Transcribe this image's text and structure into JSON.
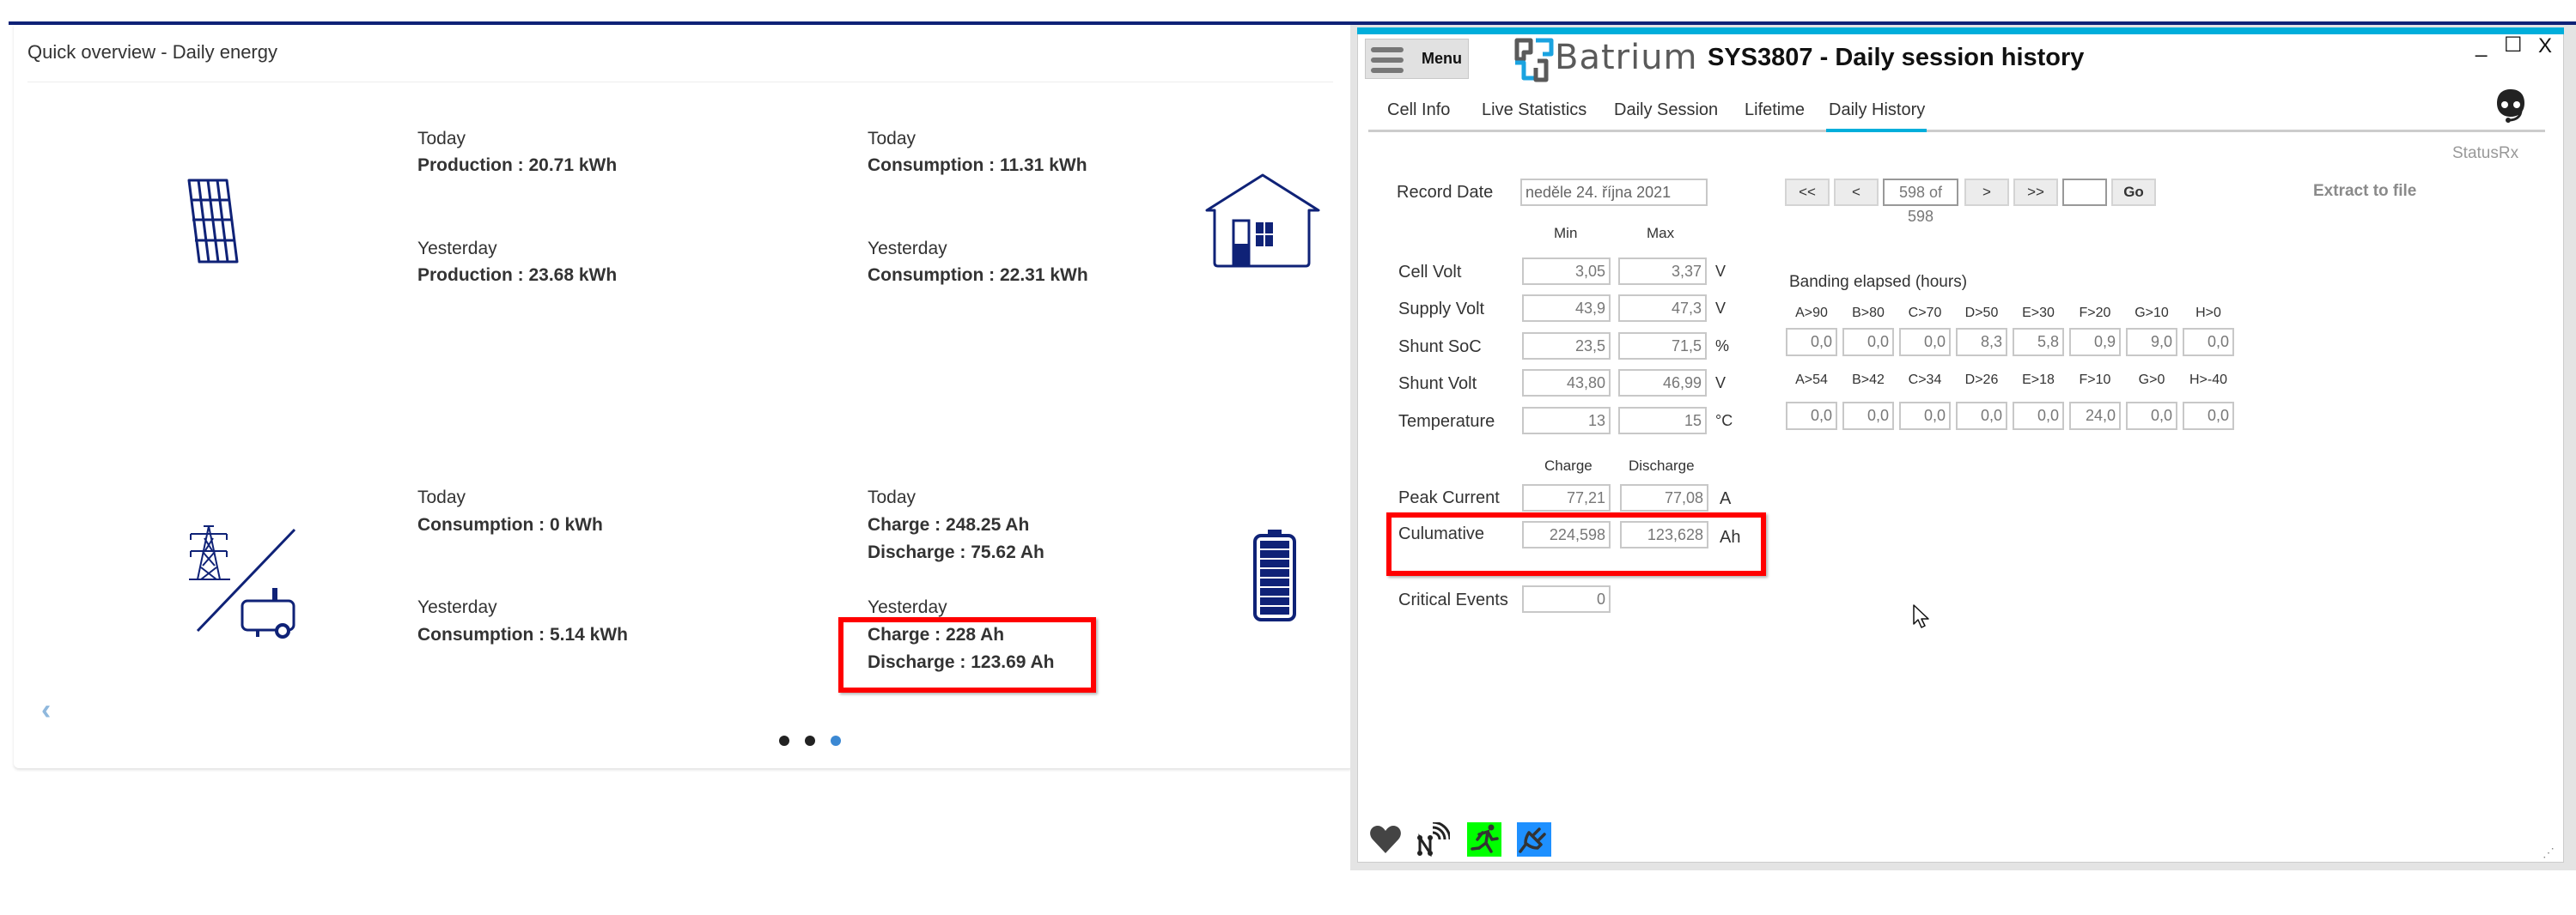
{
  "overview": {
    "title": "Quick overview - Daily energy",
    "sections": [
      {
        "icon": "solar-panel-icon",
        "today_label": "Today",
        "today_values": [
          "Production : 20.71 kWh"
        ],
        "yesterday_label": "Yesterday",
        "yesterday_values": [
          "Production : 23.68 kWh"
        ]
      },
      {
        "icon": "house-icon",
        "today_label": "Today",
        "today_values": [
          "Consumption : 11.31 kWh"
        ],
        "yesterday_label": "Yesterday",
        "yesterday_values": [
          "Consumption : 22.31 kWh"
        ]
      },
      {
        "icon": "grid-generator-icon",
        "today_label": "Today",
        "today_values": [
          "Consumption : 0 kWh"
        ],
        "yesterday_label": "Yesterday",
        "yesterday_values": [
          "Consumption : 5.14 kWh"
        ]
      },
      {
        "icon": "battery-icon",
        "today_label": "Today",
        "today_values": [
          "Charge : 248.25 Ah",
          "Discharge : 75.62 Ah"
        ],
        "yesterday_label": "Yesterday",
        "yesterday_values": [
          "Charge : 228 Ah",
          "Discharge : 123.69 Ah"
        ]
      }
    ],
    "carousel": {
      "pages": 3,
      "active_page": 3
    },
    "prev_icon": "chevron-left-icon"
  },
  "window": {
    "menu_label": "Menu",
    "logo_text": "Batrium",
    "title": "SYS3807 - Daily session history",
    "controls": {
      "minimize": "_",
      "maximize": "☐",
      "close": "X"
    },
    "tabs": [
      {
        "label": "Cell Info",
        "active": false
      },
      {
        "label": "Live Statistics",
        "active": false
      },
      {
        "label": "Daily Session",
        "active": false
      },
      {
        "label": "Lifetime",
        "active": false
      },
      {
        "label": "Daily History",
        "active": true
      }
    ],
    "status_text": "StatusRx",
    "record_date_label": "Record Date",
    "record_date_value": "neděle 24. října 2021",
    "nav": {
      "first": "<<",
      "prev": "<",
      "position": "598 of 598",
      "next": ">",
      "last": ">>",
      "goto_value": "",
      "go": "Go"
    },
    "extract_label": "Extract to file",
    "minmax_headers": {
      "min": "Min",
      "max": "Max"
    },
    "measurements": [
      {
        "label": "Cell Volt",
        "min": "3,05",
        "max": "3,37",
        "unit": "V"
      },
      {
        "label": "Supply Volt",
        "min": "43,9",
        "max": "47,3",
        "unit": "V"
      },
      {
        "label": "Shunt SoC",
        "min": "23,5",
        "max": "71,5",
        "unit": "%"
      },
      {
        "label": "Shunt Volt",
        "min": "43,80",
        "max": "46,99",
        "unit": "V"
      },
      {
        "label": "Temperature",
        "min": "13",
        "max": "15",
        "unit": "°C"
      }
    ],
    "banding": {
      "title": "Banding elapsed (hours)",
      "soc_bands": [
        {
          "label": "A>90",
          "value": "0,0"
        },
        {
          "label": "B>80",
          "value": "0,0"
        },
        {
          "label": "C>70",
          "value": "0,0"
        },
        {
          "label": "D>50",
          "value": "8,3"
        },
        {
          "label": "E>30",
          "value": "5,8"
        },
        {
          "label": "F>20",
          "value": "0,9"
        },
        {
          "label": "G>10",
          "value": "9,0"
        },
        {
          "label": "H>0",
          "value": "0,0"
        }
      ],
      "temp_bands": [
        {
          "label": "A>54",
          "value": "0,0"
        },
        {
          "label": "B>42",
          "value": "0,0"
        },
        {
          "label": "C>34",
          "value": "0,0"
        },
        {
          "label": "D>26",
          "value": "0,0"
        },
        {
          "label": "E>18",
          "value": "0,0"
        },
        {
          "label": "F>10",
          "value": "24,0"
        },
        {
          "label": "G>0",
          "value": "0,0"
        },
        {
          "label": "H>-40",
          "value": "0,0"
        }
      ]
    },
    "charge_headers": {
      "charge": "Charge",
      "discharge": "Discharge"
    },
    "peak_current": {
      "label": "Peak Current",
      "charge": "77,21",
      "discharge": "77,08",
      "unit": "A"
    },
    "cumulative": {
      "label": "Culumative",
      "charge": "224,598",
      "discharge": "123,628",
      "unit": "Ah"
    },
    "critical_events": {
      "label": "Critical Events",
      "value": "0"
    },
    "status_icons": [
      {
        "name": "heart-icon",
        "color": "#444444"
      },
      {
        "name": "network-signal-icon",
        "color": "#222222"
      },
      {
        "name": "running-man-icon",
        "color": "#00ff00"
      },
      {
        "name": "plug-icon",
        "color": "#1e90ff"
      }
    ]
  },
  "colors": {
    "brand_navy": "#0f2277",
    "accent_cyan": "#00aedb",
    "highlight_red": "#ff0000",
    "carousel_active": "#3b88d3"
  }
}
